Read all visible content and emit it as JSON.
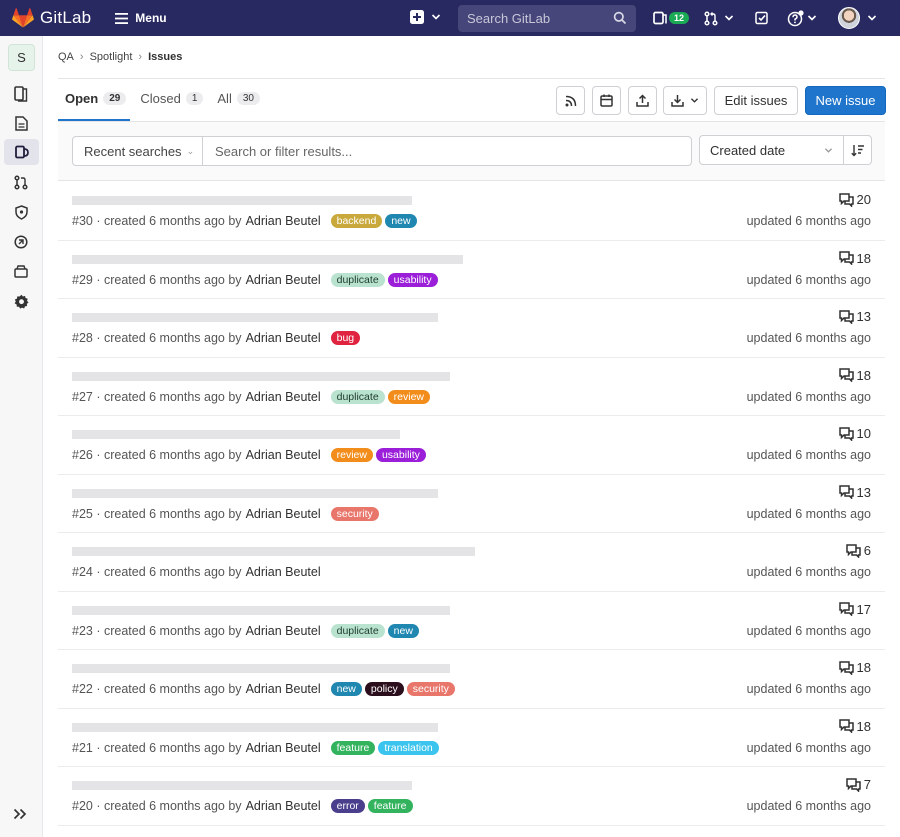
{
  "navbar": {
    "brand": "GitLab",
    "menu_label": "Menu",
    "search_placeholder": "Search GitLab",
    "issues_badge": "12"
  },
  "sidebar": {
    "project_initial": "S"
  },
  "breadcrumb": {
    "items": [
      "QA",
      "Spotlight"
    ],
    "current": "Issues"
  },
  "tabs": [
    {
      "label": "Open",
      "count": "29"
    },
    {
      "label": "Closed",
      "count": "1"
    },
    {
      "label": "All",
      "count": "30"
    }
  ],
  "actions": {
    "edit_issues": "Edit issues",
    "new_issue": "New issue"
  },
  "filter": {
    "recent_searches": "Recent searches",
    "search_placeholder": "Search or filter results...",
    "sort_by": "Created date"
  },
  "label_colors": {
    "backend": "#c9a93b",
    "new": "#1f87b0",
    "duplicate": "#b9e3cf",
    "usability": "#9b1fd8",
    "bug": "#e0233f",
    "review": "#f28c1b",
    "security": "#e8766b",
    "policy": "#2b0e1b",
    "feature": "#33b35e",
    "translation": "#3ac4ee",
    "error": "#4a3f8c"
  },
  "issues": [
    {
      "ref": "#30",
      "created": "created 6 months ago by",
      "author": "Adrian Beutel",
      "labels": [
        "backend",
        "new"
      ],
      "comments": "20",
      "updated": "updated 6 months ago"
    },
    {
      "ref": "#29",
      "created": "created 6 months ago by",
      "author": "Adrian Beutel",
      "labels": [
        "duplicate",
        "usability"
      ],
      "comments": "18",
      "updated": "updated 6 months ago"
    },
    {
      "ref": "#28",
      "created": "created 6 months ago by",
      "author": "Adrian Beutel",
      "labels": [
        "bug"
      ],
      "comments": "13",
      "updated": "updated 6 months ago"
    },
    {
      "ref": "#27",
      "created": "created 6 months ago by",
      "author": "Adrian Beutel",
      "labels": [
        "duplicate",
        "review"
      ],
      "comments": "18",
      "updated": "updated 6 months ago"
    },
    {
      "ref": "#26",
      "created": "created 6 months ago by",
      "author": "Adrian Beutel",
      "labels": [
        "review",
        "usability"
      ],
      "comments": "10",
      "updated": "updated 6 months ago"
    },
    {
      "ref": "#25",
      "created": "created 6 months ago by",
      "author": "Adrian Beutel",
      "labels": [
        "security"
      ],
      "comments": "13",
      "updated": "updated 6 months ago"
    },
    {
      "ref": "#24",
      "created": "created 6 months ago by",
      "author": "Adrian Beutel",
      "labels": [],
      "comments": "6",
      "updated": "updated 6 months ago"
    },
    {
      "ref": "#23",
      "created": "created 6 months ago by",
      "author": "Adrian Beutel",
      "labels": [
        "duplicate",
        "new"
      ],
      "comments": "17",
      "updated": "updated 6 months ago"
    },
    {
      "ref": "#22",
      "created": "created 6 months ago by",
      "author": "Adrian Beutel",
      "labels": [
        "new",
        "policy",
        "security"
      ],
      "comments": "18",
      "updated": "updated 6 months ago"
    },
    {
      "ref": "#21",
      "created": "created 6 months ago by",
      "author": "Adrian Beutel",
      "labels": [
        "feature",
        "translation"
      ],
      "comments": "18",
      "updated": "updated 6 months ago"
    },
    {
      "ref": "#20",
      "created": "created 6 months ago by",
      "author": "Adrian Beutel",
      "labels": [
        "error",
        "feature"
      ],
      "comments": "7",
      "updated": "updated 6 months ago"
    }
  ]
}
